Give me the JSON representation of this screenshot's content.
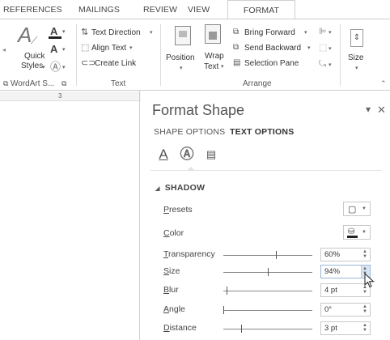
{
  "ribbon_tabs": [
    "REFERENCES",
    "MAILINGS",
    "REVIEW",
    "VIEW",
    "FORMAT"
  ],
  "ribbon": {
    "quick_styles": [
      "Quick",
      "Styles"
    ],
    "wordart_group": "WordArt S...",
    "text_direction": "Text Direction",
    "align_text": "Align Text",
    "create_link": "Create Link",
    "text_group": "Text",
    "position": "Position",
    "wrap_text": [
      "Wrap",
      "Text"
    ],
    "bring_forward": "Bring Forward",
    "send_backward": "Send Backward",
    "selection_pane": "Selection Pane",
    "arrange_group": "Arrange",
    "size": "Size"
  },
  "ruler": {
    "number": "3"
  },
  "pane": {
    "title": "Format Shape",
    "tabs": [
      "SHAPE OPTIONS",
      "TEXT OPTIONS"
    ],
    "active_tab": "TEXT OPTIONS",
    "icon_tabs": [
      "text-fill-outline-icon",
      "text-effects-icon",
      "textbox-layout-icon"
    ],
    "section": "SHADOW",
    "properties": {
      "presets": {
        "label_key": "P",
        "label_rest": "resets"
      },
      "color": {
        "label_key": "C",
        "label_rest": "olor"
      },
      "transparency": {
        "label_key": "T",
        "label_rest": "ransparency",
        "value": "60%",
        "level": 0.6
      },
      "size": {
        "label_key": "S",
        "label_rest": "ize",
        "value": "94%",
        "level": 0.5
      },
      "blur": {
        "label_key": "B",
        "label_rest": "lur",
        "value": "4 pt",
        "level": 0.04
      },
      "angle": {
        "label_key": "A",
        "label_rest": "ngle",
        "value": "0°",
        "level": 0.0
      },
      "distance": {
        "label_key": "D",
        "label_rest": "istance",
        "value": "3 pt",
        "level": 0.2
      }
    }
  },
  "colors": {
    "accent": "#9ab7d6",
    "text": "#444444",
    "border": "#c8c8c8"
  }
}
